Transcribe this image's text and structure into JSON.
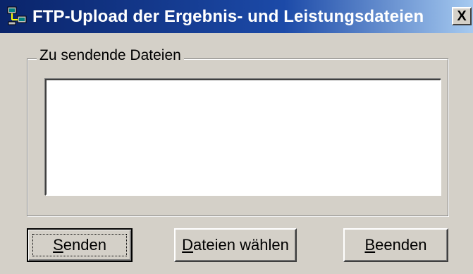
{
  "window": {
    "title": "FTP-Upload der Ergebnis- und Leistungsdateien",
    "close_label": "X",
    "app_icon": "network-computer-icon"
  },
  "group": {
    "label": "Zu sendende Dateien",
    "files": []
  },
  "buttons": {
    "send": {
      "accel": "S",
      "rest": "enden"
    },
    "choose": {
      "accel": "D",
      "rest": "ateien wählen"
    },
    "quit": {
      "accel": "B",
      "rest": "eenden"
    }
  },
  "colors": {
    "titlebar_start": "#0a246a",
    "titlebar_end": "#a6caf0",
    "face": "#d4d0c8"
  }
}
